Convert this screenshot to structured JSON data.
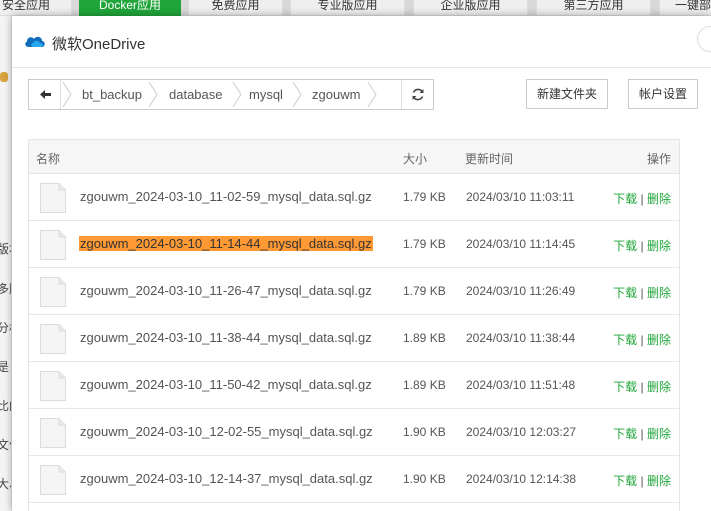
{
  "background": {
    "tabs": [
      {
        "label": "安全应用",
        "active": false
      },
      {
        "label": "Docker应用",
        "active": true
      },
      {
        "label": "免费应用",
        "active": false
      },
      {
        "label": "专业版应用",
        "active": false
      },
      {
        "label": "企业版应用",
        "active": false
      },
      {
        "label": "第三方应用",
        "active": false
      },
      {
        "label": "一键部署",
        "active": false
      }
    ],
    "left_fragments": [
      "版本",
      "多服",
      "分析",
      "是",
      "比的",
      "文件",
      "大、"
    ]
  },
  "dialog": {
    "title": "微软OneDrive",
    "icon": "onedrive-cloud-icon"
  },
  "path": {
    "crumbs": [
      "bt_backup",
      "database",
      "mysql",
      "zgouwm"
    ]
  },
  "toolbar": {
    "new_folder": "新建文件夹",
    "account_settings": "帐户设置"
  },
  "table": {
    "headers": {
      "name": "名称",
      "size": "大小",
      "time": "更新时间",
      "action": "操作"
    },
    "download_label": "下载",
    "separator": "|",
    "delete_label": "删除",
    "rows": [
      {
        "name": "zgouwm_2024-03-10_11-02-59_mysql_data.sql.gz",
        "size": "1.79 KB",
        "time": "2024/03/10 11:03:11",
        "highlighted": false
      },
      {
        "name": "zgouwm_2024-03-10_11-14-44_mysql_data.sql.gz",
        "size": "1.79 KB",
        "time": "2024/03/10 11:14:45",
        "highlighted": true
      },
      {
        "name": "zgouwm_2024-03-10_11-26-47_mysql_data.sql.gz",
        "size": "1.79 KB",
        "time": "2024/03/10 11:26:49",
        "highlighted": false
      },
      {
        "name": "zgouwm_2024-03-10_11-38-44_mysql_data.sql.gz",
        "size": "1.89 KB",
        "time": "2024/03/10 11:38:44",
        "highlighted": false
      },
      {
        "name": "zgouwm_2024-03-10_11-50-42_mysql_data.sql.gz",
        "size": "1.89 KB",
        "time": "2024/03/10 11:51:48",
        "highlighted": false
      },
      {
        "name": "zgouwm_2024-03-10_12-02-55_mysql_data.sql.gz",
        "size": "1.90 KB",
        "time": "2024/03/10 12:03:27",
        "highlighted": false
      },
      {
        "name": "zgouwm_2024-03-10_12-14-37_mysql_data.sql.gz",
        "size": "1.90 KB",
        "time": "2024/03/10 12:14:38",
        "highlighted": false
      }
    ]
  },
  "colors": {
    "accent": "#20a53a",
    "highlight": "#ff9934"
  }
}
